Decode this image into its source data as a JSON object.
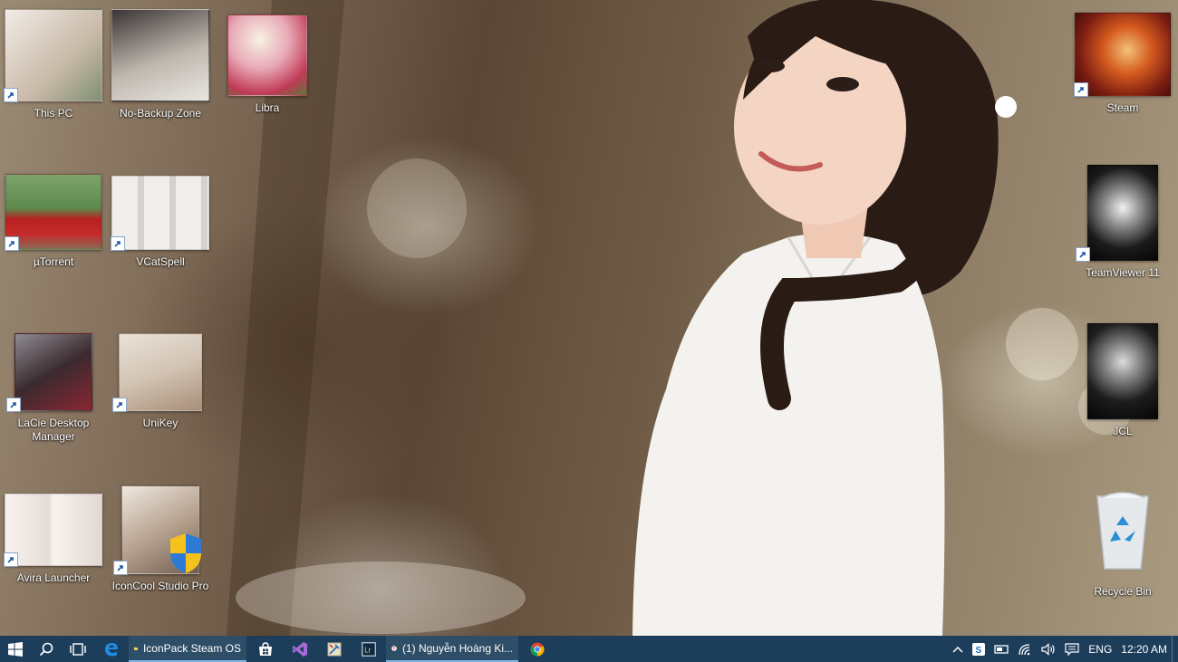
{
  "desktop": {
    "icons": [
      {
        "label": "This PC",
        "shortcut": true
      },
      {
        "label": "No-Backup Zone",
        "shortcut": false
      },
      {
        "label": "Libra",
        "shortcut": false
      },
      {
        "label": "µTorrent",
        "shortcut": true
      },
      {
        "label": "VCatSpell",
        "shortcut": true
      },
      {
        "label": "LaCie Desktop Manager",
        "shortcut": true
      },
      {
        "label": "UniKey",
        "shortcut": true
      },
      {
        "label": "Avira Launcher",
        "shortcut": true
      },
      {
        "label": "IconCool Studio Pro",
        "shortcut": true
      },
      {
        "label": "Steam",
        "shortcut": true
      },
      {
        "label": "TeamViewer 11",
        "shortcut": true
      },
      {
        "label": "JCL",
        "shortcut": false
      },
      {
        "label": "Recycle Bin",
        "shortcut": false
      }
    ]
  },
  "taskbar": {
    "start_icon": "windows-logo-icon",
    "search_icon": "search-icon",
    "taskview_icon": "task-view-icon",
    "pinned": [
      {
        "name": "edge-icon",
        "running": false
      },
      {
        "name": "file-explorer-icon",
        "running": true,
        "label": "IconPack Steam OS"
      },
      {
        "name": "store-icon",
        "running": false
      },
      {
        "name": "visual-studio-icon",
        "running": false
      },
      {
        "name": "tool-icon",
        "running": false
      },
      {
        "name": "lightroom-icon",
        "running": false
      },
      {
        "name": "yandex-browser-icon",
        "running": true,
        "label": "(1) Nguyễn Hoàng Ki..."
      },
      {
        "name": "chrome-icon",
        "running": false
      }
    ],
    "tray": {
      "language": "ENG",
      "time": "12:20 AM"
    }
  },
  "colors": {
    "taskbar": "#1d3e5b",
    "accent": "#7fb4e6"
  }
}
